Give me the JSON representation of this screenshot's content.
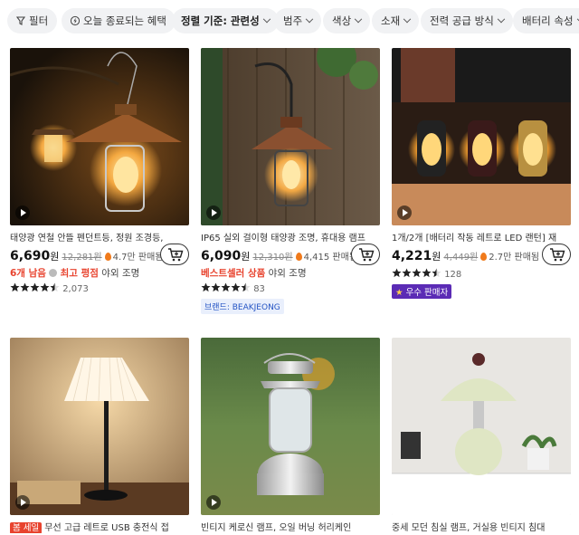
{
  "filters": [
    {
      "label": "필터",
      "icon": "filter-icon"
    },
    {
      "label": "오늘 종료되는 혜택",
      "icon": "lightning-icon"
    },
    {
      "label": "정렬 기준: 관련성",
      "dropdown": true
    },
    {
      "label": "범주",
      "dropdown": true
    },
    {
      "label": "색상",
      "dropdown": true
    },
    {
      "label": "소재",
      "dropdown": true
    },
    {
      "label": "전력 공급 방식",
      "dropdown": true
    },
    {
      "label": "배터리 속성",
      "dropdown": true
    }
  ],
  "products": [
    {
      "title": "태양광 연철 안뜰 펜던트등, 정원 조경등,",
      "price": "6,690",
      "currency": "원",
      "original_price": "12,281원",
      "sold": "4.7만 판매됨",
      "meta_highlight": "6개 남음",
      "meta_highlight2": "최고 평점",
      "meta_category": "야외 조명",
      "rating": 4.5,
      "reviews": "2,073"
    },
    {
      "title": "IP65 실외 걸이형 태양광 조명, 휴대용 램프",
      "price": "6,090",
      "currency": "원",
      "original_price": "12,310원",
      "sold": "4,415 판매됨",
      "meta_highlight": "베스트셀러 상품",
      "meta_category": "야외 조명",
      "rating": 4.5,
      "reviews": "83",
      "brand": "브랜드: BEAKJEONG"
    },
    {
      "title": "1개/2개 [배터리 작동 레트로 LED 랜턴] 재",
      "price": "4,221",
      "currency": "원",
      "original_price": "4,449원",
      "sold": "2.7만 판매됨",
      "rating": 4.5,
      "reviews": "128",
      "seller_badge": "우수 판매자"
    },
    {
      "title": "무선 고급 레트로 USB 충전식 접",
      "sale_tag": "봄 세일",
      "image": "pleated-lamp"
    },
    {
      "title": "빈티지 케로신 램프, 오일 버닝 허리케인",
      "image": "kerosene-lamp"
    },
    {
      "title": "중세 모던 침실 램프, 거실용 빈티지 침대",
      "image": "mushroom-lamp"
    }
  ],
  "colors": {
    "accent_red": "#e8432e",
    "flame_orange": "#f07a1b",
    "brand_blue": "#2454c4",
    "seller_purple": "#5b2bb5",
    "chip_bg": "#f1f2f4"
  }
}
